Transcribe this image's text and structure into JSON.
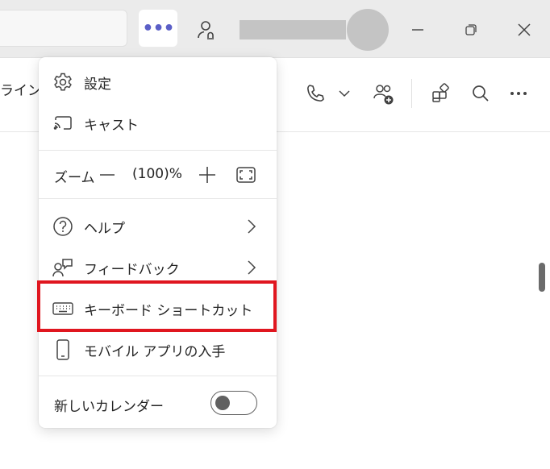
{
  "titlebar": {
    "more_label": "•••",
    "notify_icon": "person-bell-icon",
    "window_buttons": [
      "minimize-icon",
      "restore-icon",
      "close-icon"
    ]
  },
  "toolbar": {
    "tab_label": "ライン",
    "icons": [
      "phone-icon",
      "chevron-down-icon",
      "add-people-icon",
      "apps-icon",
      "search-icon",
      "more-icon"
    ]
  },
  "menu": {
    "settings": "設定",
    "cast": "キャスト",
    "zoom": {
      "label": "ズーム",
      "value": "(100)%"
    },
    "help": "ヘルプ",
    "feedback": "フィードバック",
    "keyboard_shortcuts": "キーボード ショートカット",
    "mobile_app": "モバイル アプリの入手",
    "new_calendar": {
      "label": "新しいカレンダー",
      "enabled": false
    }
  },
  "colors": {
    "accent": "#5b5fc7",
    "highlight": "#e0161f",
    "titlebar_bg": "#ebebeb"
  }
}
